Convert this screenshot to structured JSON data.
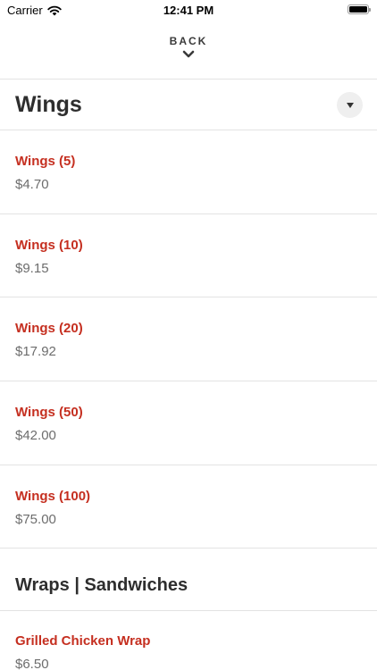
{
  "status_bar": {
    "carrier": "Carrier",
    "time": "12:41 PM",
    "icons": [
      "wifi-icon",
      "battery-icon"
    ]
  },
  "header": {
    "back_label": "BACK",
    "chevron_icon": "chevron-down-icon"
  },
  "sections": [
    {
      "title": "Wings",
      "toggle_icon": "caret-down-icon",
      "items": [
        {
          "name": "Wings (5)",
          "price": "$4.70"
        },
        {
          "name": "Wings (10)",
          "price": "$9.15"
        },
        {
          "name": "Wings (20)",
          "price": "$17.92"
        },
        {
          "name": "Wings (50)",
          "price": "$42.00"
        },
        {
          "name": "Wings (100)",
          "price": "$75.00"
        }
      ]
    },
    {
      "title": "Wraps | Sandwiches",
      "items": [
        {
          "name": "Grilled Chicken Wrap",
          "price": "$6.50"
        }
      ]
    }
  ],
  "colors": {
    "item_name": "#c52f20",
    "price": "#6d6d6d",
    "title": "#2e2e2e",
    "divider": "#e3e3e3"
  }
}
